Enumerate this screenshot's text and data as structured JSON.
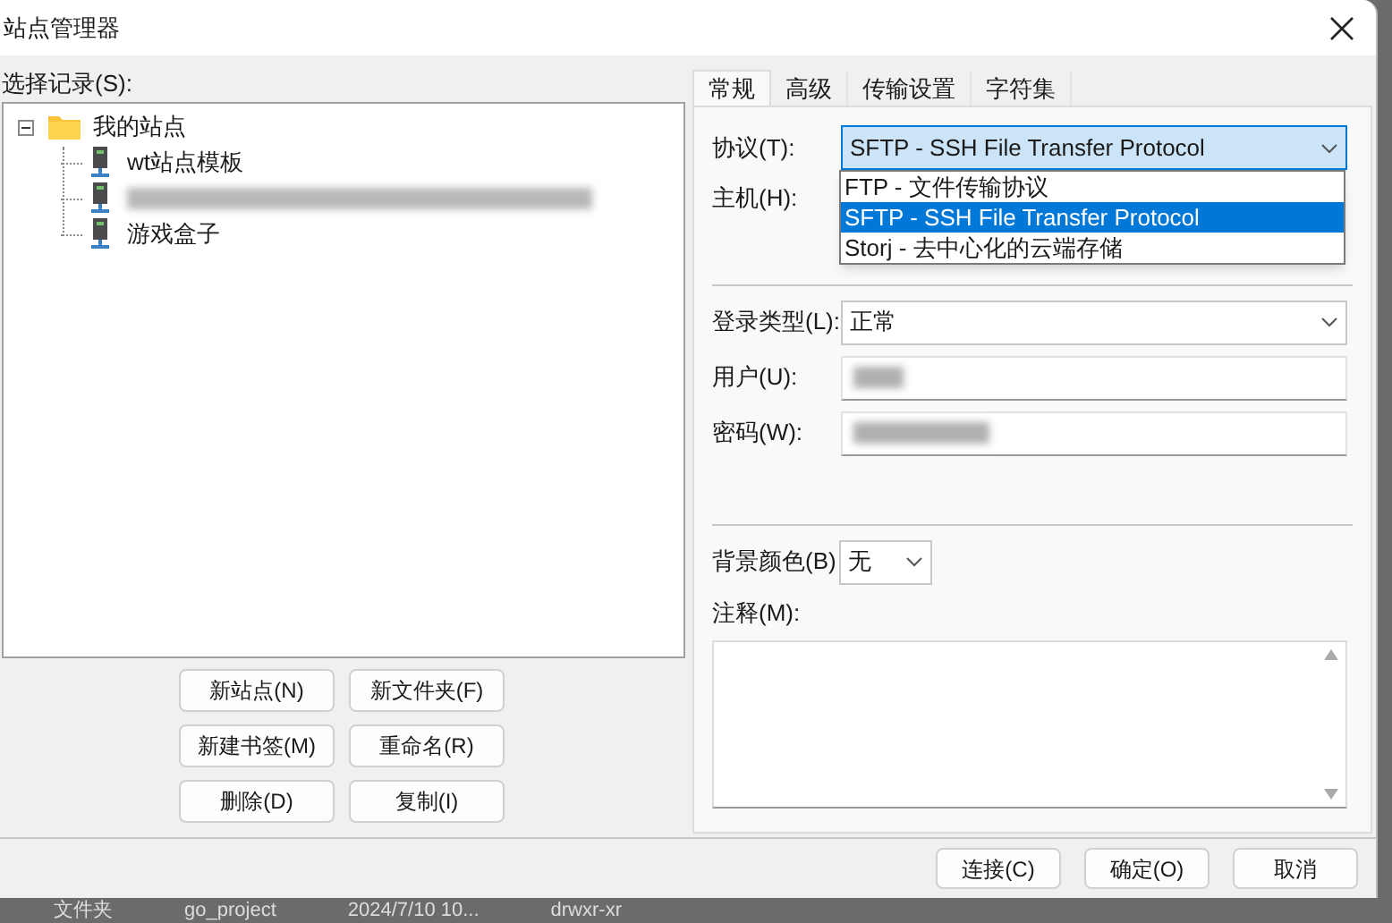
{
  "window": {
    "title": "站点管理器"
  },
  "left": {
    "label": "选择记录(S):",
    "tree": [
      {
        "kind": "folder",
        "label": "我的站点",
        "expanded": true,
        "children": [
          {
            "kind": "site",
            "label": "wt站点模板"
          },
          {
            "kind": "redacted"
          },
          {
            "kind": "site",
            "label": "游戏盒子"
          }
        ]
      }
    ],
    "buttons": [
      "新站点(N)",
      "新文件夹(F)",
      "新建书签(M)",
      "重命名(R)",
      "删除(D)",
      "复制(I)"
    ]
  },
  "tabs": [
    {
      "label": "常规",
      "selected": true
    },
    {
      "label": "高级",
      "selected": false
    },
    {
      "label": "传输设置",
      "selected": false
    },
    {
      "label": "字符集",
      "selected": false
    }
  ],
  "form": {
    "protocol": {
      "label": "协议(T):",
      "value": "SFTP - SSH File Transfer Protocol",
      "expanded": true,
      "options": [
        {
          "label": "FTP - 文件传输协议",
          "selected": false
        },
        {
          "label": "SFTP - SSH File Transfer Protocol",
          "selected": true
        },
        {
          "label": "Storj - 去中心化的云端存储",
          "selected": false
        }
      ]
    },
    "host": {
      "label": "主机(H):"
    },
    "login_type": {
      "label": "登录类型(L):",
      "value": "正常"
    },
    "user": {
      "label": "用户(U):",
      "redacted": true
    },
    "password": {
      "label": "密码(W):",
      "redacted": true
    },
    "background_color": {
      "label": "背景颜色(B)",
      "value": "无"
    },
    "notes": {
      "label": "注释(M):"
    }
  },
  "footer_buttons": [
    "连接(C)",
    "确定(O)",
    "取消"
  ],
  "background": {
    "texts": [
      "文件夹",
      "go_project",
      "2024/7/10 10...",
      "drwxr-xr"
    ]
  }
}
